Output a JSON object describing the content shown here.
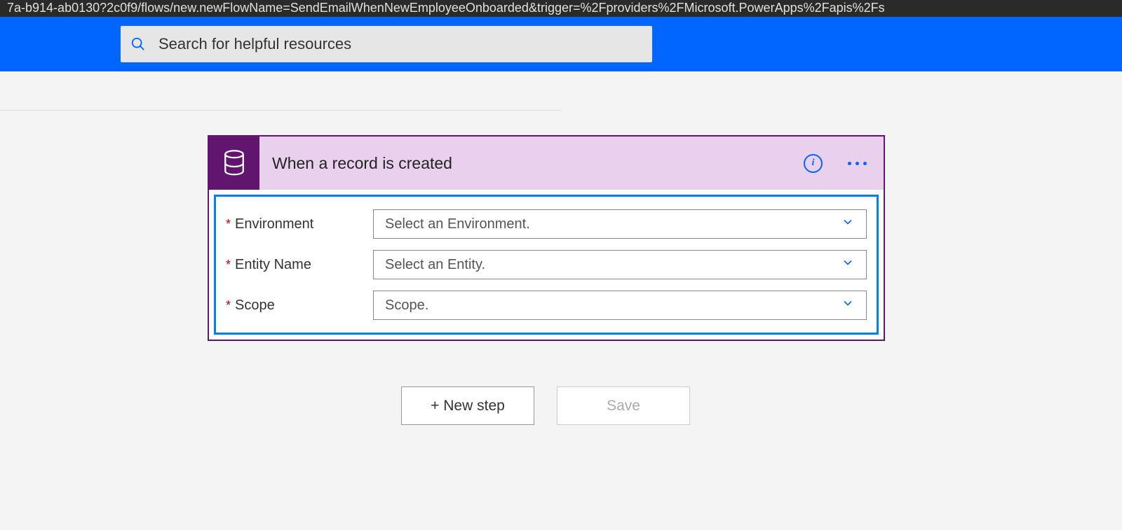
{
  "url_fragment": "7a-b914-ab0130?2c0f9/flows/new.newFlowName=SendEmailWhenNewEmployeeOnboarded&trigger=%2Fproviders%2FMicrosoft.PowerApps%2Fapis%2Fs",
  "search": {
    "placeholder": "Search for helpful resources"
  },
  "trigger_card": {
    "title": "When a record is created",
    "fields": [
      {
        "label": "Environment",
        "placeholder": "Select an Environment.",
        "required": true
      },
      {
        "label": "Entity Name",
        "placeholder": "Select an Entity.",
        "required": true
      },
      {
        "label": "Scope",
        "placeholder": "Scope.",
        "required": true
      }
    ]
  },
  "buttons": {
    "new_step": "+ New step",
    "save": "Save"
  }
}
